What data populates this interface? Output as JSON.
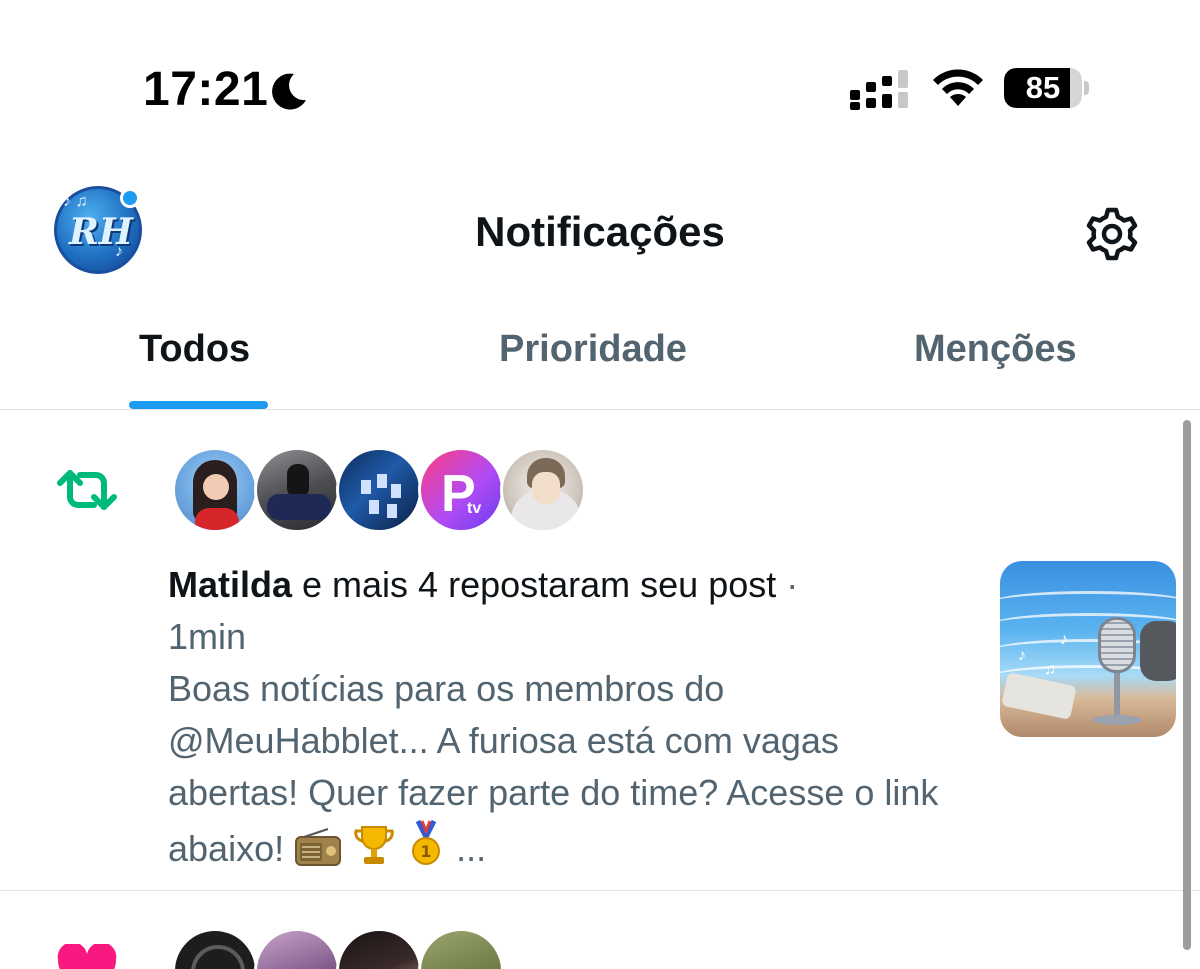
{
  "status_bar": {
    "time": "17:21",
    "battery_level": "85",
    "battery_fraction": 0.85,
    "icons": [
      "moon-icon",
      "signal-icon",
      "wifi-icon",
      "battery-icon"
    ]
  },
  "header": {
    "title": "Notificações",
    "account_avatar_text": "RH",
    "has_unread": true,
    "icons": [
      "account-avatar",
      "gear-icon"
    ]
  },
  "tabs": [
    {
      "label": "Todos",
      "active": true
    },
    {
      "label": "Prioridade",
      "active": false
    },
    {
      "label": "Menções",
      "active": false
    }
  ],
  "notifications": [
    {
      "type": "repost",
      "icon": "repost-icon",
      "actor_name": "Matilda",
      "action_text": " e mais 4 repostaram seu post",
      "separator": " ·",
      "time": "1min",
      "body": "Boas notícias para os membros do @MeuHabblet... A furiosa está com vagas abertas! Quer fazer parte do time? Acesse o link abaixo!",
      "body_emojis": [
        "radio-emoji",
        "trophy-emoji",
        "medal-emoji"
      ],
      "body_ellipsis": " ...",
      "avatar_count": 5,
      "avatar_pv_text": "tv"
    },
    {
      "type": "like",
      "icon": "heart-icon",
      "avatar_count": 4
    }
  ],
  "colors": {
    "accent": "#1d9bf0",
    "repost": "#00ba7c",
    "like": "#f91880",
    "text_primary": "#0f1419",
    "text_secondary": "#536471",
    "divider": "#dfe3e6"
  }
}
